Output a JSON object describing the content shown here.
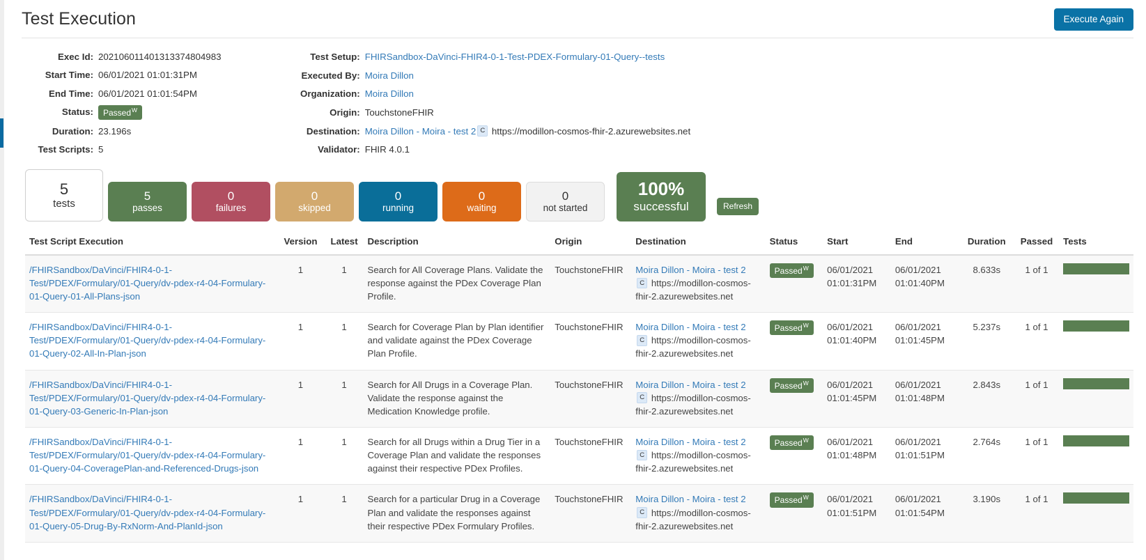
{
  "header": {
    "title": "Test Execution",
    "execute_again_label": "Execute Again"
  },
  "meta_left": [
    {
      "label": "Exec Id:",
      "value": "202106011401313374804983"
    },
    {
      "label": "Start Time:",
      "value": "06/01/2021 01:01:31PM"
    },
    {
      "label": "End Time:",
      "value": "06/01/2021 01:01:54PM"
    },
    {
      "label": "Status:",
      "value": "Passed",
      "badge_sup": "W"
    },
    {
      "label": "Duration:",
      "value": "23.196s"
    },
    {
      "label": "Test Scripts:",
      "value": "5"
    }
  ],
  "meta_right": [
    {
      "label": "Test Setup:",
      "value": "FHIRSandbox-DaVinci-FHIR4-0-1-Test-PDEX-Formulary-01-Query--tests"
    },
    {
      "label": "Executed By:",
      "value": "Moira Dillon"
    },
    {
      "label": "Organization:",
      "value": "Moira Dillon"
    },
    {
      "label": "Origin:",
      "value": "TouchstoneFHIR"
    },
    {
      "label": "Destination:",
      "value": "Moira Dillon - Moira - test 2",
      "badge": "C",
      "url": "https://modillon-cosmos-fhir-2.azurewebsites.net"
    },
    {
      "label": "Validator:",
      "value": "FHIR 4.0.1"
    }
  ],
  "counters": [
    {
      "num": "5",
      "label": "tests",
      "color": "#ffffff"
    },
    {
      "num": "5",
      "label": "passes",
      "color": "#5a7f52"
    },
    {
      "num": "0",
      "label": "failures",
      "color": "#b14f61"
    },
    {
      "num": "0",
      "label": "skipped",
      "color": "#d2a96e"
    },
    {
      "num": "0",
      "label": "running",
      "color": "#0a6e99"
    },
    {
      "num": "0",
      "label": "waiting",
      "color": "#dd6b19"
    },
    {
      "num": "0",
      "label": "not started",
      "color": "#f2f2f2"
    },
    {
      "num": "100%",
      "label": "successful",
      "color": "#5a7f52"
    }
  ],
  "refresh_label": "Refresh",
  "table": {
    "columns": [
      "Test Script Execution",
      "Version",
      "Latest",
      "Description",
      "Origin",
      "Destination",
      "Status",
      "Start",
      "End",
      "Duration",
      "Passed",
      "Tests"
    ],
    "rows": [
      {
        "script": "/FHIRSandbox/DaVinci/FHIR4-0-1-Test/PDEX/Formulary/01-Query/dv-pdex-r4-04-Formulary-01-Query-01-All-Plans-json",
        "version": "1",
        "latest": "1",
        "description": "Search for All Coverage Plans. Validate the response against the PDex Coverage Plan Profile.",
        "origin": "TouchstoneFHIR",
        "destination": "Moira Dillon - Moira - test 2",
        "destination_badge": "C",
        "destination_url": "https://modillon-cosmos-fhir-2.azurewebsites.net",
        "status": "Passed",
        "status_sup": "W",
        "start": "06/01/2021 01:01:31PM",
        "end": "06/01/2021 01:01:40PM",
        "duration": "8.633s",
        "passed": "1 of 1",
        "tests_pct": 100
      },
      {
        "script": "/FHIRSandbox/DaVinci/FHIR4-0-1-Test/PDEX/Formulary/01-Query/dv-pdex-r4-04-Formulary-01-Query-02-All-In-Plan-json",
        "version": "1",
        "latest": "1",
        "description": "Search for Coverage Plan by Plan identifier and validate against the PDex Coverage Plan Profile.",
        "origin": "TouchstoneFHIR",
        "destination": "Moira Dillon - Moira - test 2",
        "destination_badge": "C",
        "destination_url": "https://modillon-cosmos-fhir-2.azurewebsites.net",
        "status": "Passed",
        "status_sup": "W",
        "start": "06/01/2021 01:01:40PM",
        "end": "06/01/2021 01:01:45PM",
        "duration": "5.237s",
        "passed": "1 of 1",
        "tests_pct": 100
      },
      {
        "script": "/FHIRSandbox/DaVinci/FHIR4-0-1-Test/PDEX/Formulary/01-Query/dv-pdex-r4-04-Formulary-01-Query-03-Generic-In-Plan-json",
        "version": "1",
        "latest": "1",
        "description": "Search for All Drugs in a Coverage Plan. Validate the response against the Medication Knowledge profile.",
        "origin": "TouchstoneFHIR",
        "destination": "Moira Dillon - Moira - test 2",
        "destination_badge": "C",
        "destination_url": "https://modillon-cosmos-fhir-2.azurewebsites.net",
        "status": "Passed",
        "status_sup": "W",
        "start": "06/01/2021 01:01:45PM",
        "end": "06/01/2021 01:01:48PM",
        "duration": "2.843s",
        "passed": "1 of 1",
        "tests_pct": 100
      },
      {
        "script": "/FHIRSandbox/DaVinci/FHIR4-0-1-Test/PDEX/Formulary/01-Query/dv-pdex-r4-04-Formulary-01-Query-04-CoveragePlan-and-Referenced-Drugs-json",
        "version": "1",
        "latest": "1",
        "description": "Search for all Drugs within a Drug Tier in a Coverage Plan and validate the responses against their respective PDex Profiles.",
        "origin": "TouchstoneFHIR",
        "destination": "Moira Dillon - Moira - test 2",
        "destination_badge": "C",
        "destination_url": "https://modillon-cosmos-fhir-2.azurewebsites.net",
        "status": "Passed",
        "status_sup": "W",
        "start": "06/01/2021 01:01:48PM",
        "end": "06/01/2021 01:01:51PM",
        "duration": "2.764s",
        "passed": "1 of 1",
        "tests_pct": 100
      },
      {
        "script": "/FHIRSandbox/DaVinci/FHIR4-0-1-Test/PDEX/Formulary/01-Query/dv-pdex-r4-04-Formulary-01-Query-05-Drug-By-RxNorm-And-PlanId-json",
        "version": "1",
        "latest": "1",
        "description": "Search for a particular Drug in a Coverage Plan and validate the responses against their respective PDex Formulary Profiles.",
        "origin": "TouchstoneFHIR",
        "destination": "Moira Dillon - Moira - test 2",
        "destination_badge": "C",
        "destination_url": "https://modillon-cosmos-fhir-2.azurewebsites.net",
        "status": "Passed",
        "status_sup": "W",
        "start": "06/01/2021 01:01:51PM",
        "end": "06/01/2021 01:01:54PM",
        "duration": "3.190s",
        "passed": "1 of 1",
        "tests_pct": 100
      }
    ]
  }
}
